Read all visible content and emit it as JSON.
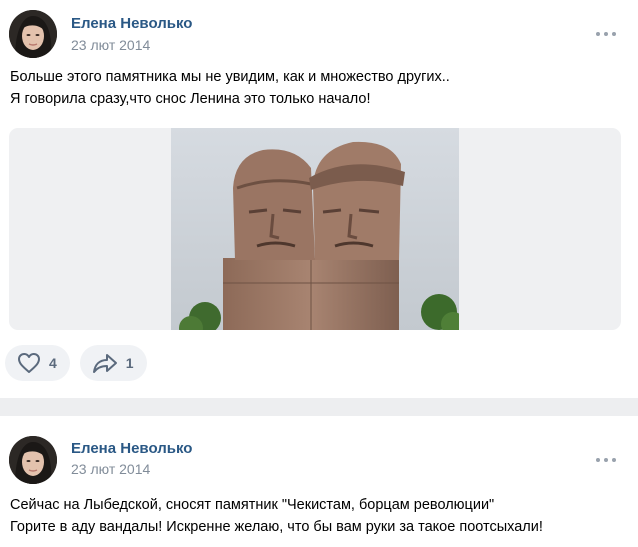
{
  "posts": [
    {
      "author": "Елена Неволько",
      "date": "23 лют 2014",
      "text_lines": [
        "Больше этого памятника мы не увидим, как и множество других..",
        "Я говорила сразу,что снос Ленина это только начало!"
      ],
      "photo_icon": "monument-photo",
      "likes": "4",
      "shares": "1"
    },
    {
      "author": "Елена Неволько",
      "date": "23 лют 2014",
      "text_lines": [
        "Сейчас на Лыбедской, сносят памятник \"Чекистам, борцам революции\"",
        "Горите в аду вандалы! Искренне желаю, что бы вам руки за такое поотсыхали!"
      ]
    }
  ],
  "colors": {
    "author": "#2a5885",
    "date": "#818c99",
    "action_bg": "#f0f2f5",
    "separator": "#edeef0"
  },
  "icons": [
    "heart-icon",
    "share-icon",
    "more-icon"
  ]
}
